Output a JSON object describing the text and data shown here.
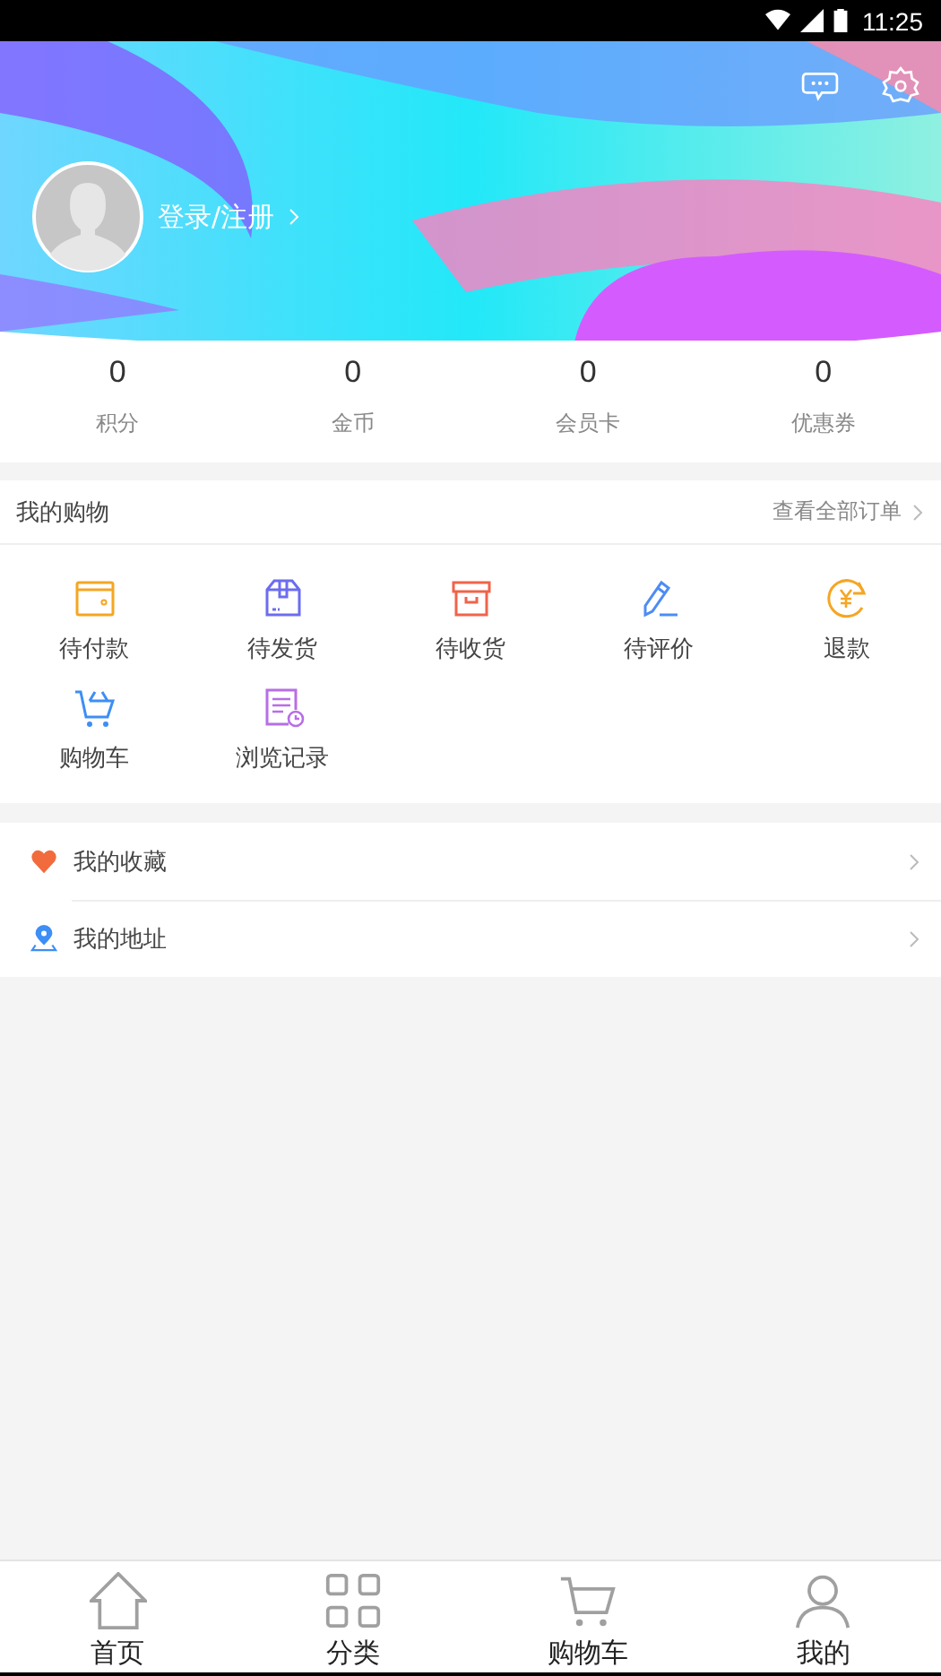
{
  "status_bar": {
    "time": "11:25"
  },
  "profile": {
    "login_label": "登录/注册"
  },
  "stats": [
    {
      "value": "0",
      "label": "积分"
    },
    {
      "value": "0",
      "label": "金币"
    },
    {
      "value": "0",
      "label": "会员卡"
    },
    {
      "value": "0",
      "label": "优惠券"
    }
  ],
  "shopping": {
    "title": "我的购物",
    "view_all": "查看全部订单",
    "items": [
      {
        "kind": "wallet",
        "label": "待付款"
      },
      {
        "kind": "package",
        "label": "待发货"
      },
      {
        "kind": "box",
        "label": "待收货"
      },
      {
        "kind": "pen",
        "label": "待评价"
      },
      {
        "kind": "refund",
        "label": "退款"
      },
      {
        "kind": "cart",
        "label": "购物车"
      },
      {
        "kind": "history",
        "label": "浏览记录"
      }
    ]
  },
  "menu": [
    {
      "kind": "heart",
      "label": "我的收藏"
    },
    {
      "kind": "pin",
      "label": "我的地址"
    }
  ],
  "tab_bar": [
    {
      "kind": "home",
      "label": "首页"
    },
    {
      "kind": "grid",
      "label": "分类"
    },
    {
      "kind": "cart",
      "label": "购物车"
    },
    {
      "kind": "user",
      "label": "我的"
    }
  ]
}
